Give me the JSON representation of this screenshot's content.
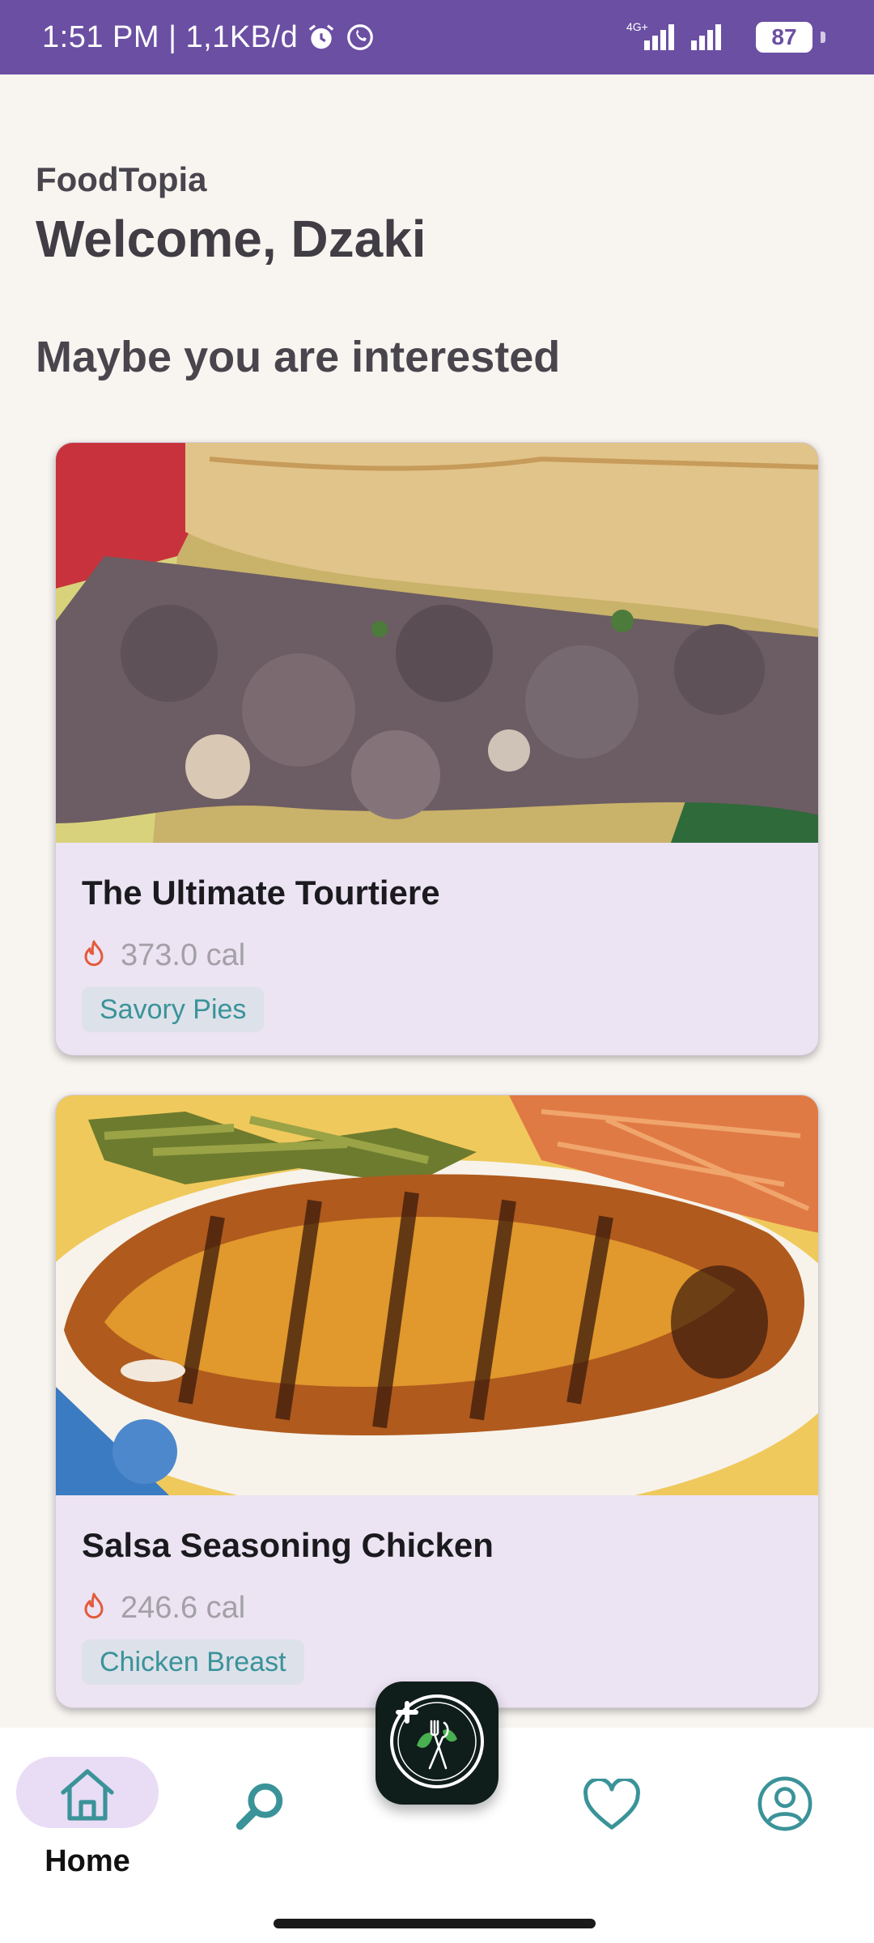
{
  "status_bar": {
    "time_text": "1:51 PM | 1,1KB/d",
    "network": "4G+",
    "battery": "87",
    "icons": [
      "alarm-icon",
      "whatsapp-icon",
      "signal-icon",
      "battery-icon"
    ]
  },
  "header": {
    "app_name": "FoodTopia",
    "welcome": "Welcome, Dzaki"
  },
  "section": {
    "title": "Maybe you are interested"
  },
  "recipes": [
    {
      "title": "The Ultimate Tourtiere",
      "calories": "373.0 cal",
      "category": "Savory Pies",
      "image": "meat-pie-photo"
    },
    {
      "title": "Salsa Seasoning Chicken",
      "calories": "246.6 cal",
      "category": "Chicken Breast",
      "image": "grilled-chicken-photo"
    }
  ],
  "bottom_nav": {
    "items": [
      {
        "label": "Home",
        "icon": "home-icon",
        "active": true
      },
      {
        "label": "",
        "icon": "search-icon",
        "active": false
      },
      {
        "label": "",
        "icon": "add-recipe-icon",
        "active": false
      },
      {
        "label": "",
        "icon": "heart-icon",
        "active": false
      },
      {
        "label": "",
        "icon": "profile-icon",
        "active": false
      }
    ]
  },
  "colors": {
    "status_bar": "#6b4fa3",
    "background": "#f8f5f1",
    "card": "#ece4f3",
    "accent_teal": "#3a9399",
    "flame": "#e35a3a",
    "fab": "#0f1d1b",
    "active_pill": "#e9dcf5"
  }
}
